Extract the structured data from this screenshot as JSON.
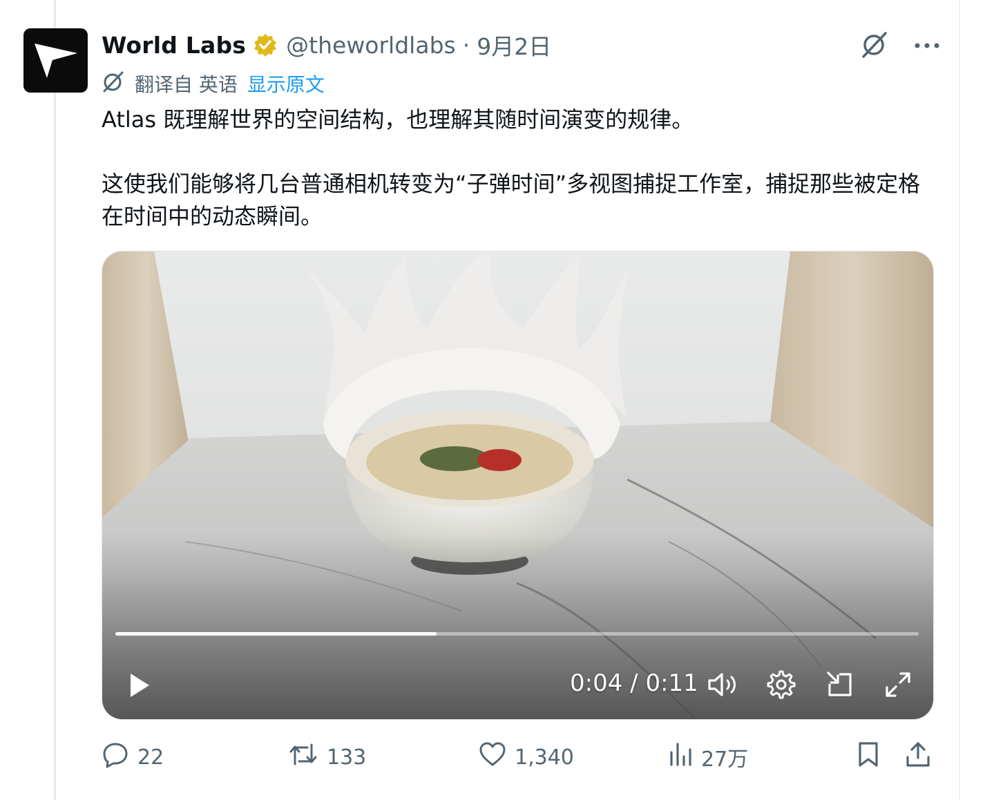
{
  "tweet": {
    "author_name": "World Labs",
    "handle": "@theworldlabs",
    "separator": "·",
    "date": "9月2日",
    "translated_from": "翻译自 英语",
    "show_original": "显示原文",
    "paragraphs": [
      "Atlas 既理解世界的空间结构，也理解其随时间演变的规律。",
      "这使我们能够将几台普通相机转变为“子弹时间”多视图捕捉工作室，捕捉那些被定格在时间中的动态瞬间。"
    ]
  },
  "video": {
    "current_time": "0:04",
    "time_separator": " / ",
    "duration": "0:11",
    "progress_fraction": 0.4
  },
  "actions": {
    "replies": "22",
    "reposts": "133",
    "likes": "1,340",
    "views": "27万"
  },
  "colors": {
    "text": "#0f1419",
    "muted": "#536471",
    "link": "#1d9bf0",
    "verified_badge": "#e2b719"
  },
  "icons": [
    "grok-icon",
    "more-icon",
    "translate-icon",
    "play-icon",
    "volume-icon",
    "settings-icon",
    "pip-icon",
    "fullscreen-icon",
    "reply-icon",
    "repost-icon",
    "like-icon",
    "views-icon",
    "bookmark-icon",
    "share-icon"
  ]
}
